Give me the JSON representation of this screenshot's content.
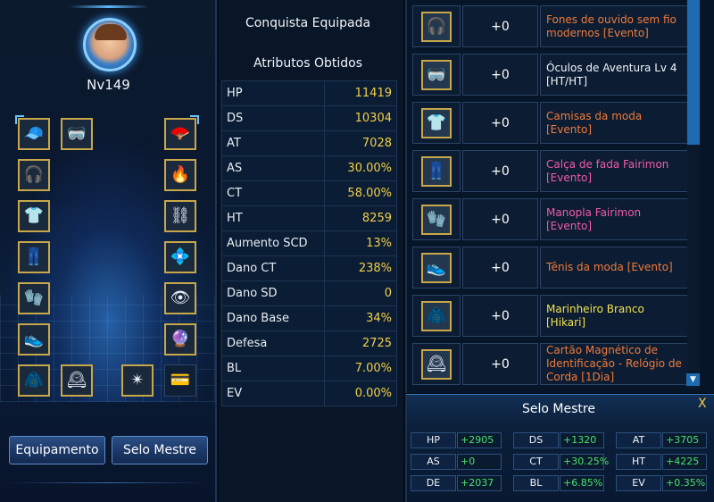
{
  "character": {
    "level": "Nv149",
    "buttons": {
      "equipment": "Equipamento",
      "master_seal": "Selo Mestre"
    },
    "slots": [
      {
        "icon": "cap-icon",
        "glyph": "🧢"
      },
      {
        "icon": "goggles-icon",
        "glyph": "🥽"
      },
      {
        "icon": "fan-icon",
        "glyph": "🪭"
      },
      {
        "icon": "earphones-icon",
        "glyph": "🎧"
      },
      {
        "icon": "fire-ring-icon",
        "glyph": "🔥"
      },
      {
        "icon": "shirt-icon",
        "glyph": "👕"
      },
      {
        "icon": "chain-icon",
        "glyph": "⛓"
      },
      {
        "icon": "pants-icon",
        "glyph": "👖"
      },
      {
        "icon": "crystal-icon",
        "glyph": "💠"
      },
      {
        "icon": "glove-icon",
        "glyph": "🧤"
      },
      {
        "icon": "eye-icon",
        "glyph": "👁"
      },
      {
        "icon": "shoes-icon",
        "glyph": "👟"
      },
      {
        "icon": "orb-icon",
        "glyph": "🔮"
      },
      {
        "icon": "jacket-icon",
        "glyph": "🧥"
      },
      {
        "icon": "clock-card-icon",
        "glyph": "🕰"
      },
      {
        "icon": "seal-icon",
        "glyph": "✴"
      },
      {
        "icon": "card-icon",
        "glyph": "💳"
      }
    ]
  },
  "stats": {
    "equipped_achievement_title": "Conquista Equipada",
    "attributes_title": "Atributos Obtidos",
    "rows": [
      {
        "key": "HP",
        "value": "11419"
      },
      {
        "key": "DS",
        "value": "10304"
      },
      {
        "key": "AT",
        "value": "7028"
      },
      {
        "key": "AS",
        "value": "30.00%"
      },
      {
        "key": "CT",
        "value": "58.00%"
      },
      {
        "key": "HT",
        "value": "8259"
      },
      {
        "key": "Aumento SCD",
        "value": "13%"
      },
      {
        "key": "Dano CT",
        "value": "238%"
      },
      {
        "key": "Dano SD",
        "value": "0"
      },
      {
        "key": "Dano Base",
        "value": "34%"
      },
      {
        "key": "Defesa",
        "value": "2725"
      },
      {
        "key": "BL",
        "value": "7.00%"
      },
      {
        "key": "EV",
        "value": "0.00%"
      }
    ]
  },
  "items": [
    {
      "icon": "earphones-icon",
      "glyph": "🎧",
      "bonus": "+0",
      "name": "Fones de ouvido sem fio modernos [Evento]",
      "color": "#f07a3a"
    },
    {
      "icon": "goggles-icon",
      "glyph": "🥽",
      "bonus": "+0",
      "name": "Óculos de Aventura Lv 4 [HT/HT]",
      "color": "#f2f5fa"
    },
    {
      "icon": "shirt-icon",
      "glyph": "👕",
      "bonus": "+0",
      "name": "Camisas da moda [Evento]",
      "color": "#f07a3a"
    },
    {
      "icon": "pants-icon",
      "glyph": "👖",
      "bonus": "+0",
      "name": "Calça de fada Fairimon [Evento]",
      "color": "#f25aa8"
    },
    {
      "icon": "glove-icon",
      "glyph": "🧤",
      "bonus": "+0",
      "name": "Manopla Fairimon [Evento]",
      "color": "#f25aa8"
    },
    {
      "icon": "shoes-icon",
      "glyph": "👟",
      "bonus": "+0",
      "name": "Tênis da moda [Evento]",
      "color": "#f07a3a"
    },
    {
      "icon": "jacket-icon",
      "glyph": "🧥",
      "bonus": "+0",
      "name": "Marinheiro Branco [Hikari]",
      "color": "#f3e14e"
    },
    {
      "icon": "clock-card-icon",
      "glyph": "🕰",
      "bonus": "+0",
      "name": "Cartão Magnético de Identificação - Relógio de Corda [1Dia]",
      "color": "#f07a3a"
    }
  ],
  "master_seal": {
    "title": "Selo Mestre",
    "close": "X",
    "rows": [
      [
        {
          "key": "HP",
          "value": "+2905"
        },
        {
          "key": "DS",
          "value": "+1320"
        },
        {
          "key": "AT",
          "value": "+3705"
        }
      ],
      [
        {
          "key": "AS",
          "value": "+0"
        },
        {
          "key": "CT",
          "value": "+30.25%"
        },
        {
          "key": "HT",
          "value": "+4225"
        }
      ],
      [
        {
          "key": "DE",
          "value": "+2037"
        },
        {
          "key": "BL",
          "value": "+6.85%"
        },
        {
          "key": "EV",
          "value": "+0.35%"
        }
      ]
    ]
  },
  "colors": {
    "accent": "#1e6bb0",
    "stat_value": "#f2cf4a",
    "seal_value": "#4be06a",
    "item_event": "#f07a3a",
    "item_fairimon": "#f25aa8",
    "item_hikari": "#f3e14e"
  }
}
